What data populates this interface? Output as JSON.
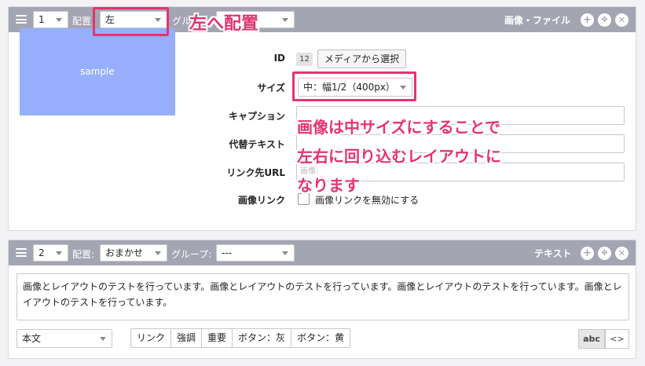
{
  "block1": {
    "order": "1",
    "placement_label": "配置",
    "placement_value": "左",
    "group_label_partial": "グル",
    "title": "画像・ファイル",
    "image_text": "sample",
    "id_label": "ID",
    "id_value": "12",
    "media_button": "メディアから選択",
    "size_label": "サイズ",
    "size_value": "中：幅1/2（400px）",
    "caption_label": "キャプション",
    "alt_label": "代替テキスト",
    "link_label": "リンク先URL",
    "link_placeholder": "画像:",
    "imagelink_label": "画像リンク",
    "imagelink_checkbox_label": "画像リンクを無効にする"
  },
  "block2": {
    "order": "2",
    "placement_label": "配置:",
    "placement_value": "おまかせ",
    "group_label": "グループ:",
    "group_value": "---",
    "title": "テキスト",
    "body": "画像とレイアウトのテストを行っています。画像とレイアウトのテストを行っています。画像とレイアウトのテストを行っています。画像とレイアウトのテストを行っています。",
    "style_value": "本文",
    "buttons": [
      "リンク",
      "強調",
      "重要",
      "ボタン：灰",
      "ボタン：黄"
    ],
    "toggle_abc": "abc",
    "toggle_code": "<>"
  },
  "annotations": {
    "placement_note": "左へ配置",
    "size_note_line1": "画像は中サイズにすることで",
    "size_note_line2": "左右に回り込むレイアウトに",
    "size_note_line3": "なります"
  },
  "icons": [
    "hamburger-icon",
    "plus-icon",
    "move-icon",
    "close-icon"
  ],
  "colors": {
    "header": "#a4a5b3",
    "accent": "#e6336e",
    "sample": "#97aefc"
  }
}
